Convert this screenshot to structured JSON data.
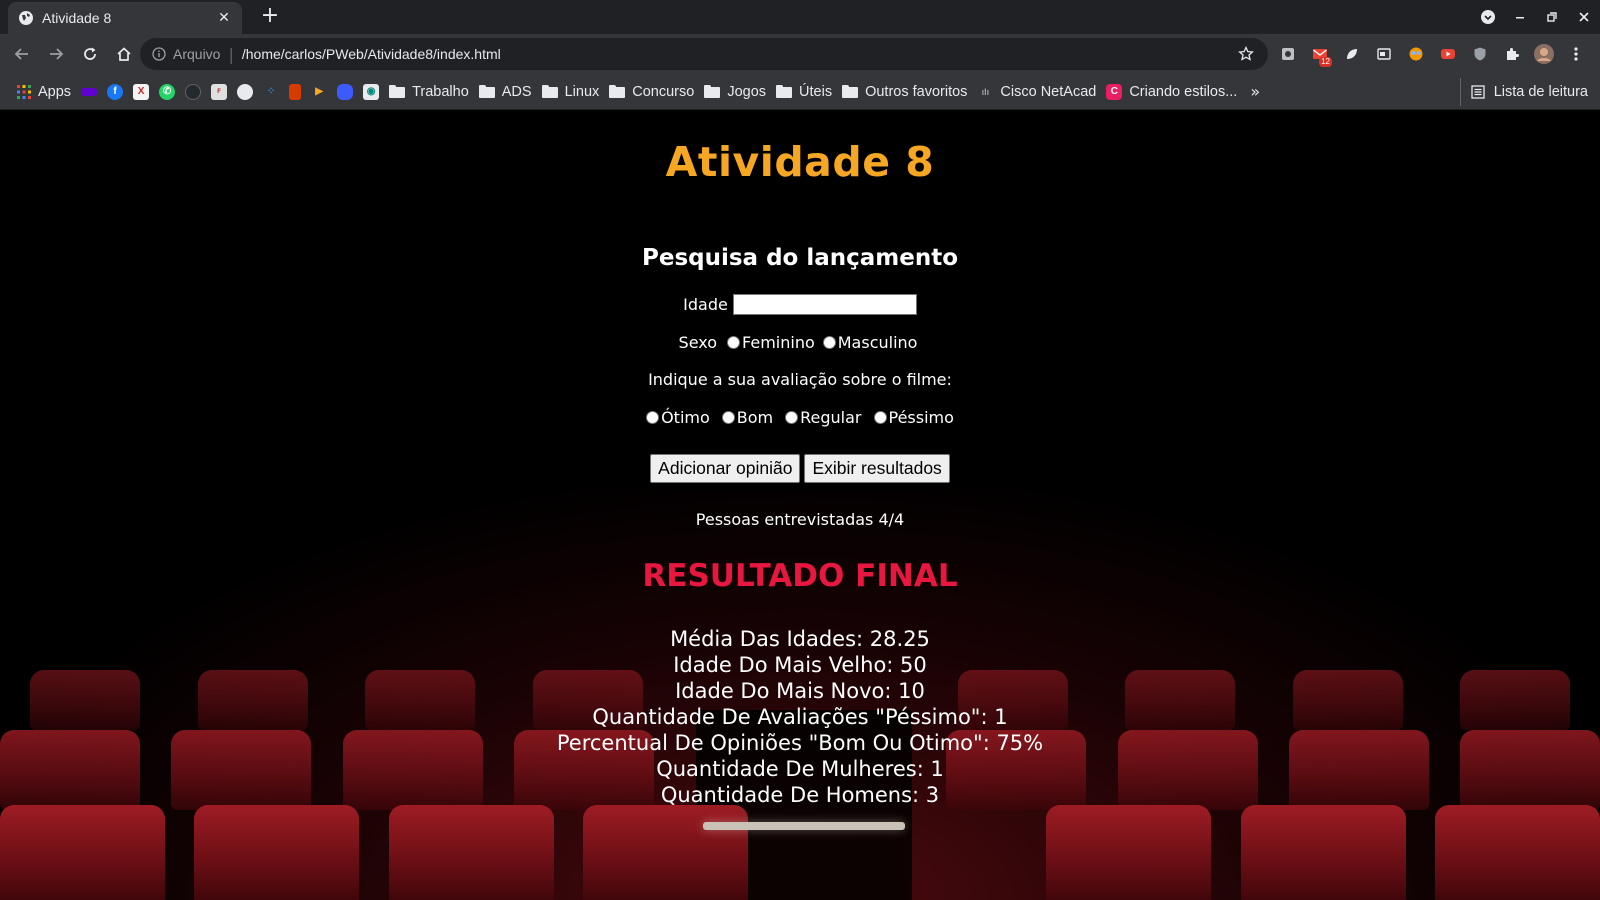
{
  "browser": {
    "tab_title": "Atividade 8",
    "tab_close": "✕",
    "new_tab": "+",
    "omnibox_label": "Arquivo",
    "omnibox_separator": "|",
    "url": "/home/carlos/PWeb/Atividade8/index.html",
    "extension_badge": "12",
    "bookmarks": {
      "apps": "Apps",
      "folders": [
        "Trabalho",
        "ADS",
        "Linux",
        "Concurso",
        "Jogos",
        "Úteis",
        "Outros favoritos"
      ],
      "cisco": "Cisco NetAcad",
      "criando": "Criando estilos...",
      "more": "»",
      "reading_list": "Lista de leitura"
    }
  },
  "page": {
    "title": "Atividade 8",
    "survey_title": "Pesquisa do lançamento",
    "age_label": "Idade",
    "age_value": "",
    "sex_label": "Sexo",
    "sex_options": [
      "Feminino",
      "Masculino"
    ],
    "rating_prompt": "Indique a sua avaliação sobre o filme:",
    "rating_options": [
      "Ótimo",
      "Bom",
      "Regular",
      "Péssimo"
    ],
    "buttons": {
      "add": "Adicionar opinião",
      "show": "Exibir resultados"
    },
    "counter": "Pessoas entrevistadas 4/4",
    "final_title": "RESULTADO FINAL",
    "results": [
      "Média Das Idades: 28.25",
      "Idade Do Mais Velho: 50",
      "Idade Do Mais Novo: 10",
      "Quantidade De Avaliações \"Péssimo\": 1",
      "Percentual De Opiniões \"Bom Ou Otimo\": 75%",
      "Quantidade De Mulheres: 1",
      "Quantidade De Homens: 3"
    ]
  },
  "colors": {
    "title": "#f5a623",
    "final_title": "#e8173f",
    "seats": "#9e1c24"
  }
}
